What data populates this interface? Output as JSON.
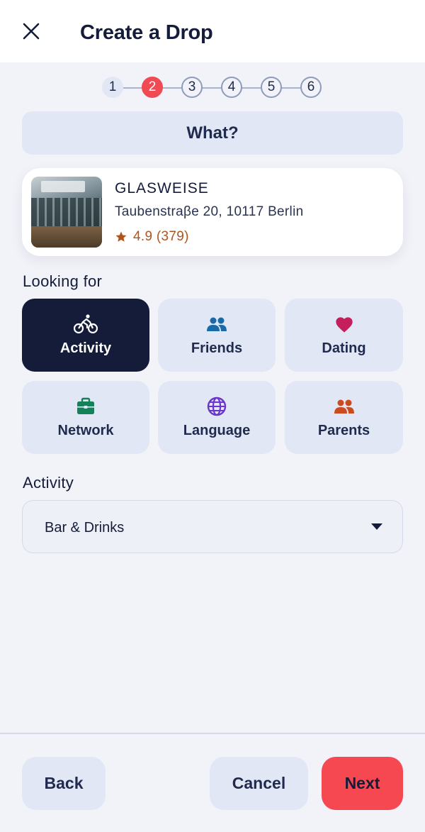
{
  "header": {
    "title": "Create a Drop",
    "close_icon": "close-icon"
  },
  "stepper": {
    "steps": [
      "1",
      "2",
      "3",
      "4",
      "5",
      "6"
    ],
    "current": "2",
    "active_color": "#f04a53"
  },
  "section": {
    "title": "What?"
  },
  "place": {
    "name": "GLASWEISE",
    "address": "Taubenstraβe 20, 10117 Berlin",
    "rating": "4.9 (379)",
    "rating_icon": "star-icon",
    "rating_color": "#b0541b"
  },
  "looking_for": {
    "label": "Looking for",
    "options": [
      {
        "label": "Activity",
        "icon": "bicycle-icon",
        "color": "#ffffff",
        "selected": true
      },
      {
        "label": "Friends",
        "icon": "people-icon",
        "color": "#1a6aa8",
        "selected": false
      },
      {
        "label": "Dating",
        "icon": "heart-icon",
        "color": "#c41e5c",
        "selected": false
      },
      {
        "label": "Network",
        "icon": "briefcase-icon",
        "color": "#15805a",
        "selected": false
      },
      {
        "label": "Language",
        "icon": "globe-icon",
        "color": "#6b35c9",
        "selected": false
      },
      {
        "label": "Parents",
        "icon": "family-icon",
        "color": "#cc4b1e",
        "selected": false
      }
    ]
  },
  "activity": {
    "label": "Activity",
    "value": "Bar & Drinks"
  },
  "footer": {
    "back_label": "Back",
    "cancel_label": "Cancel",
    "next_label": "Next",
    "next_color": "#f54851"
  }
}
